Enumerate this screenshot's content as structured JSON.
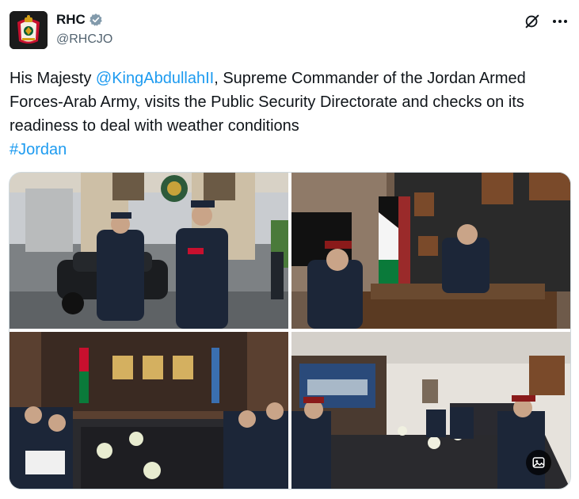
{
  "author": {
    "display_name": "RHC",
    "handle": "@RHCJO",
    "verified_icon": "verified-badge-icon",
    "avatar_icon": "royal-coat-of-arms-icon"
  },
  "header_actions": {
    "grok_icon": "grok-icon",
    "more_icon": "more-options-icon"
  },
  "post": {
    "text_before_mention": "His Majesty ",
    "mention": "@KingAbdullahII",
    "text_after_mention": ", Supreme Commander of the Jordan Armed Forces-Arab Army, visits the Public Security Directorate and checks on its readiness to deal with weather conditions",
    "hashtag": "#Jordan"
  },
  "media": {
    "photos": [
      {
        "name": "photo-king-walking-outdoors"
      },
      {
        "name": "photo-office-meeting"
      },
      {
        "name": "photo-conference-hall-meeting"
      },
      {
        "name": "photo-command-room-meeting"
      }
    ],
    "alt_button_icon": "image-alt-icon"
  },
  "colors": {
    "link": "#1d9bf0",
    "text": "#0f1419",
    "secondary_text": "#536471",
    "border": "#cfd9de"
  }
}
